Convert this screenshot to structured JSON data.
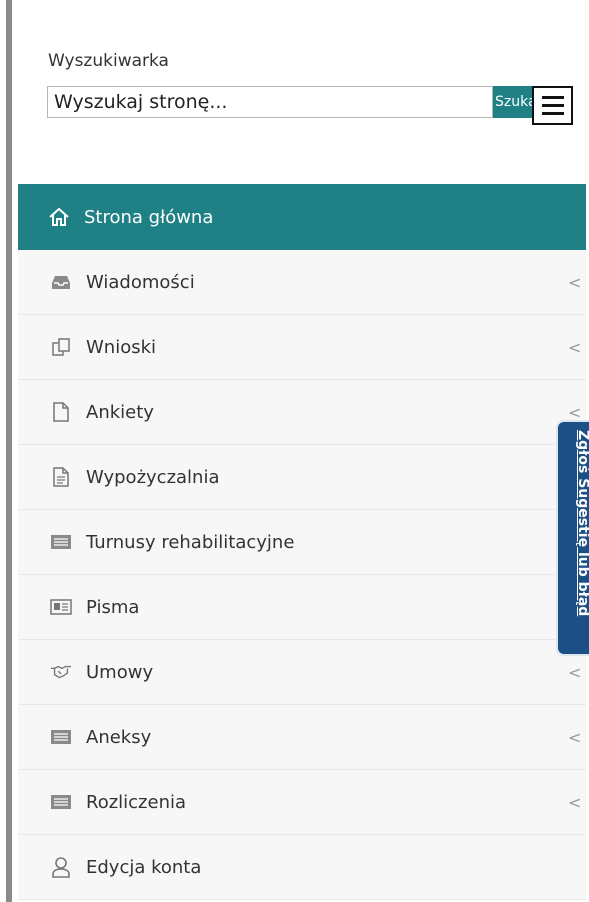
{
  "search": {
    "label": "Wyszukiwarka",
    "placeholder": "Wyszukaj stronę...",
    "value": "",
    "button": "Szukaj"
  },
  "menu": {
    "items": [
      {
        "label": "Strona główna",
        "icon": "home-icon",
        "active": true,
        "chevron": ""
      },
      {
        "label": "Wiadomości",
        "icon": "inbox-icon",
        "chevron": "<"
      },
      {
        "label": "Wnioski",
        "icon": "documents-icon",
        "chevron": "<"
      },
      {
        "label": "Ankiety",
        "icon": "file-icon",
        "chevron": "<"
      },
      {
        "label": "Wypożyczalnia",
        "icon": "file-text-icon",
        "chevron": "<"
      },
      {
        "label": "Turnusy rehabilitacyjne",
        "icon": "list-card-icon",
        "chevron": "<"
      },
      {
        "label": "Pisma",
        "icon": "newspaper-icon",
        "chevron": "<"
      },
      {
        "label": "Umowy",
        "icon": "handshake-icon",
        "chevron": "<"
      },
      {
        "label": "Aneksy",
        "icon": "list-card-icon",
        "chevron": "<"
      },
      {
        "label": "Rozliczenia",
        "icon": "list-card-icon",
        "chevron": "<"
      },
      {
        "label": "Edycja konta",
        "icon": "user-icon",
        "chevron": ""
      }
    ]
  },
  "feedback": {
    "label": "Zgłoś Sugestię lub błąd"
  },
  "colors": {
    "accent": "#1f8185",
    "feedback": "#1c4f86"
  }
}
